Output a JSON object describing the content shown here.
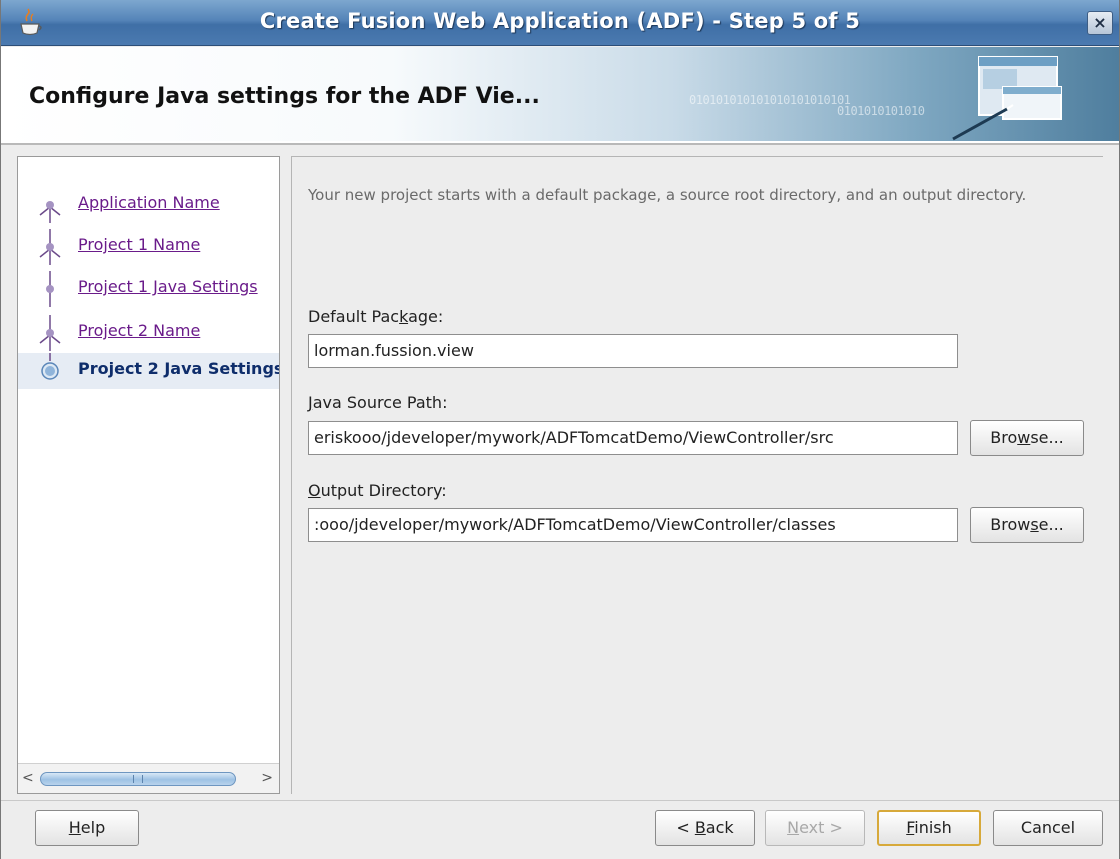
{
  "window": {
    "title": "Create Fusion Web Application (ADF) - Step 5 of 5",
    "close_label": "×"
  },
  "header": {
    "title": "Configure Java settings for the ADF Vie...",
    "binary_line1": "010101010101010101010101",
    "binary_line2": "0101010101010"
  },
  "nav": {
    "items": [
      {
        "label": "Application Name",
        "state": "visited"
      },
      {
        "label": "Project 1 Name",
        "state": "visited"
      },
      {
        "label": "Project 1 Java Settings",
        "state": "visited"
      },
      {
        "label": "Project 2 Name",
        "state": "visited"
      },
      {
        "label": "Project 2 Java Settings",
        "state": "current"
      }
    ],
    "scroll_left": "<",
    "scroll_right": ">"
  },
  "content": {
    "description": "Your new project starts with a default package, a source root directory, and an output directory.",
    "default_package": {
      "label_pre": "Default Pac",
      "mnemonic": "k",
      "label_post": "age:",
      "value": "lorman.fussion.view"
    },
    "java_source_path": {
      "label_pre": "",
      "mnemonic": "J",
      "label_post": "ava Source Path:",
      "value": "eriskooo/jdeveloper/mywork/ADFTomcatDemo/ViewController/src",
      "browse_pre": "Bro",
      "browse_mnemonic": "w",
      "browse_post": "se..."
    },
    "output_directory": {
      "label_pre": "",
      "mnemonic": "O",
      "label_post": "utput Directory:",
      "value": ":ooo/jdeveloper/mywork/ADFTomcatDemo/ViewController/classes",
      "browse_pre": "Brow",
      "browse_mnemonic": "s",
      "browse_post": "e..."
    }
  },
  "footer": {
    "help": {
      "mnemonic": "H",
      "rest": "elp"
    },
    "back": {
      "pre": "< ",
      "mnemonic": "B",
      "rest": "ack"
    },
    "next": {
      "mnemonic": "N",
      "rest": "ext >"
    },
    "finish": {
      "mnemonic": "F",
      "rest": "inish"
    },
    "cancel": "Cancel"
  },
  "colors": {
    "titlebar": "#5584b8",
    "visited_link": "#6a1b8a",
    "current_step": "#0e2d6b",
    "default_button_border": "#d7a93a"
  }
}
